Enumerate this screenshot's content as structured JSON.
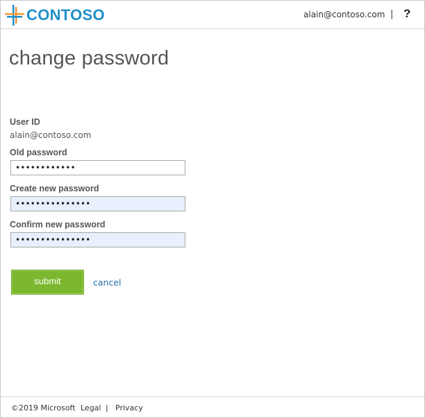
{
  "header": {
    "brand": "CONTOSO",
    "user_email": "alain@contoso.com",
    "separator": "|",
    "help_label": "?"
  },
  "page": {
    "title": "change password"
  },
  "form": {
    "user_id_label": "User ID",
    "user_id_value": "alain@contoso.com",
    "old_password_label": "Old password",
    "old_password_value": "••••••••••••",
    "new_password_label": "Create new password",
    "new_password_value": "•••••••••••••••",
    "confirm_password_label": "Confirm new password",
    "confirm_password_value": "•••••••••••••••",
    "submit_label": "submit",
    "cancel_label": "cancel"
  },
  "footer": {
    "copyright": "©2019 Microsoft",
    "legal": "Legal",
    "separator": "|",
    "privacy": "Privacy"
  },
  "colors": {
    "brand_blue": "#1e8fc9",
    "logo_orange": "#f39a3c",
    "submit_green": "#7cb82f",
    "autofill_bg": "#e8f0fe",
    "link_blue": "#1e6ca8"
  }
}
